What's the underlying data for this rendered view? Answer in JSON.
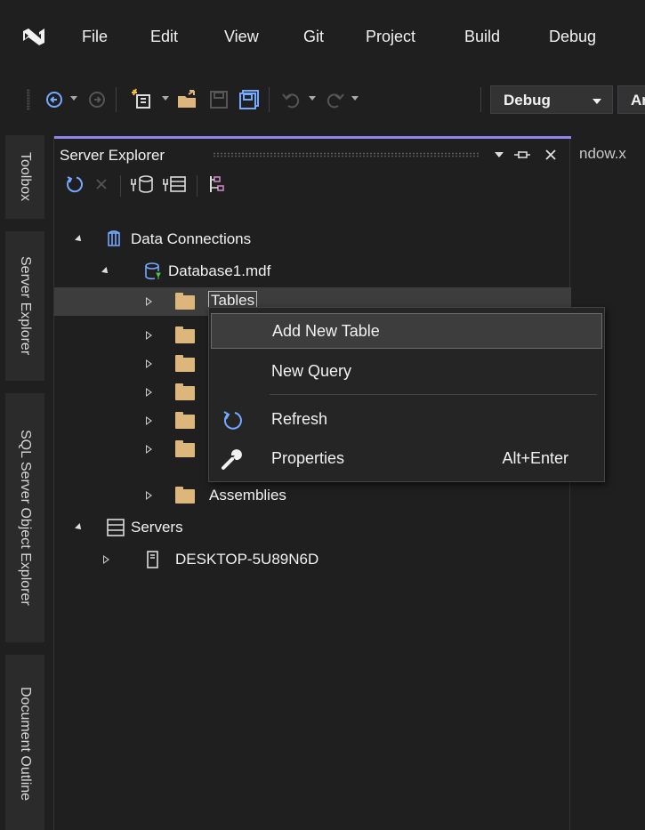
{
  "menubar": {
    "logo_icon": "visual-studio-logo-icon",
    "items": [
      "File",
      "Edit",
      "View",
      "Git",
      "Project",
      "Build",
      "Debug"
    ]
  },
  "toolbar": {
    "config_value": "Debug",
    "platform_value": "Ar"
  },
  "left_rail": {
    "tabs": [
      "Toolbox",
      "Server Explorer",
      "SQL Server Object Explorer",
      "Document Outline"
    ]
  },
  "panel": {
    "title": "Server Explorer",
    "accent_color": "#9184ee"
  },
  "tree": {
    "data_connections": "Data Connections",
    "database": "Database1.mdf",
    "tables": "Tables",
    "assemblies": "Assemblies",
    "servers": "Servers",
    "server_name": "DESKTOP-5U89N6D"
  },
  "context_menu": {
    "items": [
      {
        "label": "Add New Table",
        "icon": "",
        "shortcut": ""
      },
      {
        "label": "New Query",
        "icon": "",
        "shortcut": ""
      },
      {
        "label": "Refresh",
        "icon": "refresh-icon",
        "shortcut": ""
      },
      {
        "label": "Properties",
        "icon": "wrench-icon",
        "shortcut": "Alt+Enter"
      }
    ]
  },
  "editor": {
    "tab_fragment": "ndow.x"
  }
}
